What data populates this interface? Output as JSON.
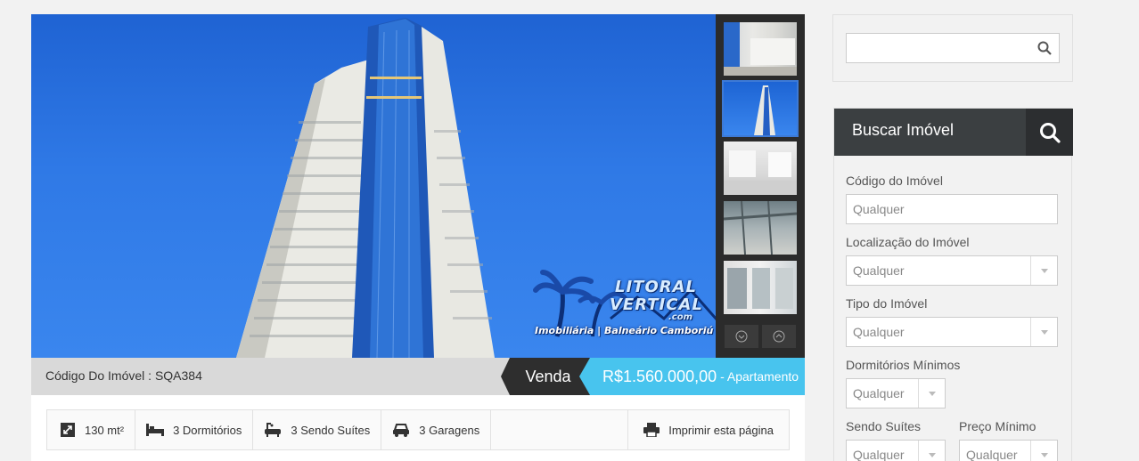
{
  "gallery": {
    "watermark": {
      "brand_line1": "LITORAL",
      "brand_line2": "VERTICAL",
      "domain": ".com",
      "tagline": "Imobiliária | Balneário Camboriú"
    },
    "thumbnails": [
      {
        "name": "living-room-window"
      },
      {
        "name": "tower-exterior",
        "active": true
      },
      {
        "name": "empty-living-room"
      },
      {
        "name": "balcony-view"
      },
      {
        "name": "window-city-view"
      }
    ]
  },
  "listing": {
    "code_label": "Código Do Imóvel : SQA384",
    "type_badge": "Venda",
    "price": "R$1.560.000,00",
    "price_suffix": "- Apartamento"
  },
  "features": {
    "area": "130 mt²",
    "bedrooms": "3 Dormitórios",
    "suites": "3 Sendo Suítes",
    "garages": "3 Garagens",
    "print": "Imprimir esta página"
  },
  "sidebar": {
    "search": {
      "placeholder": ""
    },
    "buscar": {
      "title": "Buscar Imóvel",
      "fields": {
        "codigo_label": "Código do Imóvel",
        "codigo_placeholder": "Qualquer",
        "localizacao_label": "Localização do Imóvel",
        "localizacao_value": "Qualquer",
        "tipo_label": "Tipo do Imóvel",
        "tipo_value": "Qualquer",
        "dormitorios_label": "Dormitórios Mínimos",
        "dormitorios_value": "Qualquer",
        "suites_label": "Sendo Suítes",
        "suites_value": "Qualquer",
        "preco_label": "Preço Mínimo",
        "preco_value": "Qualquer"
      }
    }
  },
  "colors": {
    "price_accent": "#48c4ee",
    "dark_tag": "#2e2e2e",
    "sidebar_header": "#3b3f41"
  }
}
